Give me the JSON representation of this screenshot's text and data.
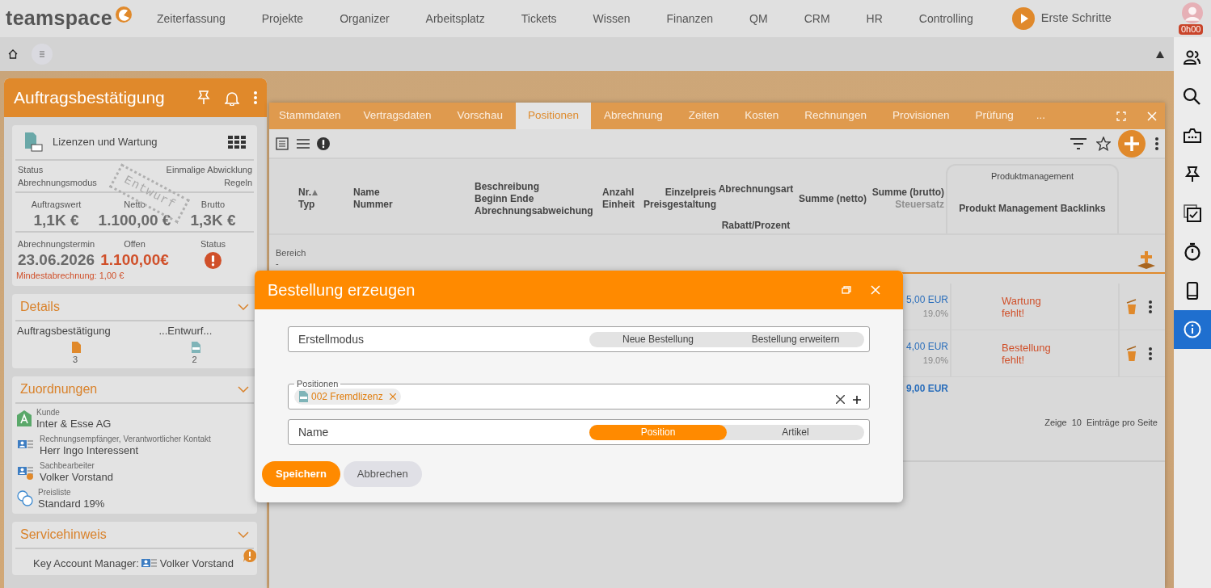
{
  "logo": {
    "text": "teamspace"
  },
  "nav": [
    {
      "label": "Zeiterfassung"
    },
    {
      "label": "Projekte"
    },
    {
      "label": "Organizer"
    },
    {
      "label": "Arbeitsplatz"
    },
    {
      "label": "Tickets"
    },
    {
      "label": "Wissen"
    },
    {
      "label": "Finanzen"
    },
    {
      "label": "QM"
    },
    {
      "label": "CRM"
    },
    {
      "label": "HR"
    },
    {
      "label": "Controlling"
    }
  ],
  "getting_started": {
    "label": "Erste Schritte"
  },
  "user": {
    "timer": "0h00"
  },
  "right_sidebar": [
    {
      "kind": "contacts",
      "selected": false
    },
    {
      "kind": "search",
      "selected": false
    },
    {
      "kind": "messages",
      "selected": false
    },
    {
      "kind": "pin",
      "selected": false
    },
    {
      "kind": "tasks",
      "selected": false
    },
    {
      "kind": "timer",
      "selected": false
    },
    {
      "kind": "mobile",
      "selected": false
    },
    {
      "kind": "info",
      "selected": true
    }
  ],
  "record_panel": {
    "title": "Auftragsbestätigung",
    "type_label": "Lizenzen und Wartung",
    "stamp": "Entwurf",
    "info_rows": [
      {
        "label": "Status",
        "value": "Einmalige Abwicklung"
      },
      {
        "label": "Abrechnungsmodus",
        "value": "Regeln"
      }
    ],
    "stats": [
      {
        "label": "Auftragswert",
        "value": "1,1K €"
      },
      {
        "label": "Netto",
        "value": "1.100,00 €"
      },
      {
        "label": "Brutto",
        "value": "1,3K €"
      }
    ],
    "dates": [
      {
        "label": "Abrechnungstermin",
        "value": "23.06.2026",
        "kind": "value"
      },
      {
        "label": "Offen",
        "value": "1.100,00€",
        "kind": "danger"
      },
      {
        "label": "Status",
        "kind": "alert"
      }
    ],
    "warning": "Mindestabrechnung: 1,00 €",
    "details": {
      "title": "Details",
      "expanded": true,
      "items": [
        {
          "label": "Auftragsbestätigung",
          "count": "3",
          "kind": "order"
        },
        {
          "label": "...Entwurf...",
          "count": "2",
          "kind": "draft"
        }
      ]
    },
    "assignments": {
      "title": "Zuordnungen",
      "expanded": true,
      "items": [
        {
          "label": "Kunde",
          "value": "Inter & Esse AG",
          "kind": "customer"
        },
        {
          "label": "Rechnungsempfänger, Verantwortlicher Kontakt",
          "value": "Herr Ingo Interessent",
          "kind": "contact"
        },
        {
          "label": "Sachbearbeiter",
          "value": "Volker Vorstand",
          "kind": "clerk"
        },
        {
          "label": "Preisliste",
          "value": "Standard 19%",
          "kind": "pricelist"
        }
      ]
    },
    "service": {
      "title": "Servicehinweis",
      "expanded": true,
      "label": "Key Account Manager:",
      "value": "Volker Vorstand"
    }
  },
  "main_window": {
    "tabs": [
      {
        "label": "Stammdaten",
        "selected": false
      },
      {
        "label": "Vertragsdaten",
        "selected": false
      },
      {
        "label": "Vorschau",
        "selected": false
      },
      {
        "label": "Positionen",
        "selected": true
      },
      {
        "label": "Abrechnung",
        "selected": false
      },
      {
        "label": "Zeiten",
        "selected": false
      },
      {
        "label": "Kosten",
        "selected": false
      },
      {
        "label": "Rechnungen",
        "selected": false
      },
      {
        "label": "Provisionen",
        "selected": false
      },
      {
        "label": "Prüfung",
        "selected": false
      }
    ],
    "more_tabs": "...",
    "columns": [
      {
        "sorted": true,
        "lines": [
          {
            "text": "Nr.",
            "muted": false
          },
          {
            "text": "Typ",
            "muted": false
          }
        ]
      },
      {
        "sorted": false,
        "lines": [
          {
            "text": "Name",
            "muted": false
          },
          {
            "text": "Nummer",
            "muted": false
          }
        ]
      },
      {
        "sorted": false,
        "lines": [
          {
            "text": "Beschreibung",
            "muted": false
          },
          {
            "text": "Beginn Ende",
            "muted": false
          },
          {
            "text": "Abrechnungsabweichung",
            "muted": false
          }
        ]
      },
      {
        "sorted": false,
        "lines": [
          {
            "text": "Anzahl",
            "muted": false
          },
          {
            "text": "Einheit",
            "muted": false
          }
        ]
      },
      {
        "sorted": false,
        "lines": [
          {
            "text": "Einzelpreis",
            "muted": false
          },
          {
            "text": "Preisgestaltung",
            "muted": false
          }
        ]
      },
      {
        "sorted": false,
        "lines": [
          {
            "text": "Abrechnungsart",
            "muted": false
          },
          {
            "text": "Rabatt/Prozent",
            "muted": false
          }
        ]
      },
      {
        "sorted": false,
        "lines": [
          {
            "text": "Summe (netto)",
            "muted": false
          }
        ]
      },
      {
        "sorted": false,
        "lines": [
          {
            "text": "Summe (brutto)",
            "muted": false
          },
          {
            "text": "Steuersatz",
            "muted": true
          }
        ]
      }
    ],
    "column_group": {
      "title": "Produktmanagement",
      "column": "Produkt Management Backlinks"
    },
    "area": {
      "label": "Bereich",
      "value": "-"
    },
    "rows": [
      {
        "gross": "5,00 EUR",
        "tax": "19.0%",
        "note": "Wartung fehlt!"
      },
      {
        "gross": "4,00 EUR",
        "tax": "19.0%",
        "note": "Bestellung fehlt!"
      }
    ],
    "total": "9,00 EUR",
    "pager": {
      "prefix": "Zeige",
      "size": "10",
      "suffix": "Einträge pro Seite"
    }
  },
  "dialog": {
    "title": "Bestellung erzeugen",
    "mode": {
      "label": "Erstellmodus",
      "options": [
        {
          "label": "Neue Bestellung",
          "selected": false
        },
        {
          "label": "Bestellung erweitern",
          "selected": false
        }
      ]
    },
    "positions": {
      "label": "Positionen",
      "chips": [
        {
          "label": "002 Fremdlizenz"
        }
      ]
    },
    "name": {
      "label": "Name",
      "options": [
        {
          "label": "Position",
          "selected": true
        },
        {
          "label": "Artikel",
          "selected": false
        }
      ]
    },
    "buttons": [
      {
        "label": "Speichern",
        "kind": "primary"
      },
      {
        "label": "Abbrechen",
        "kind": "secondary"
      }
    ]
  }
}
